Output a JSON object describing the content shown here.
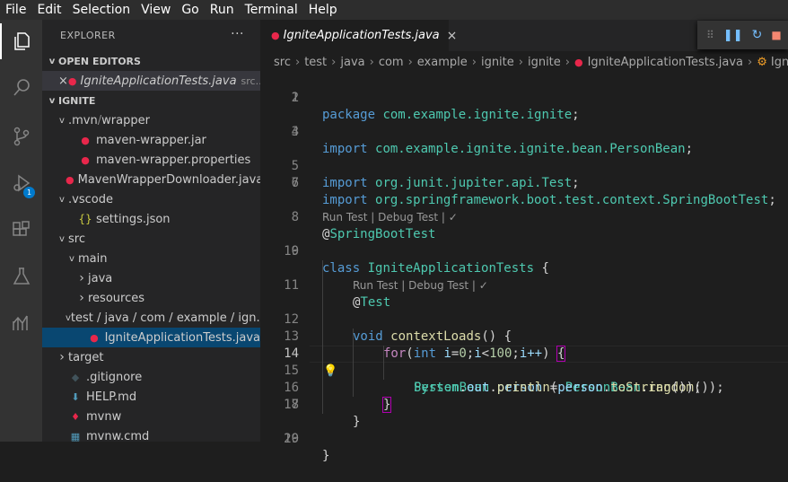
{
  "menu": [
    "File",
    "Edit",
    "Selection",
    "View",
    "Go",
    "Run",
    "Terminal",
    "Help"
  ],
  "activity": {
    "debug_badge": "1"
  },
  "sidebar": {
    "title": "EXPLORER",
    "more": "···",
    "open_editors_label": "OPEN EDITORS",
    "open_editor": {
      "name": "IgniteApplicationTests.java",
      "hint": "src..."
    },
    "project_label": "IGNITE",
    "tree": [
      {
        "label": ".mvn",
        "sep": " / ",
        "label2": "wrapper",
        "indent": 1,
        "chevron": "v",
        "icon": ""
      },
      {
        "label": "maven-wrapper.jar",
        "indent": 2,
        "chevron": "",
        "icon": "java"
      },
      {
        "label": "maven-wrapper.properties",
        "indent": 2,
        "chevron": "",
        "icon": "java"
      },
      {
        "label": "MavenWrapperDownloader.java",
        "indent": 2,
        "chevron": "",
        "icon": "java"
      },
      {
        "label": ".vscode",
        "indent": 1,
        "chevron": "v",
        "icon": ""
      },
      {
        "label": "settings.json",
        "indent": 2,
        "chevron": "",
        "icon": "json"
      },
      {
        "label": "src",
        "indent": 1,
        "chevron": "v",
        "icon": ""
      },
      {
        "label": "main",
        "indent": 2,
        "chevron": "v",
        "icon": ""
      },
      {
        "label": "java",
        "indent": 3,
        "chevron": ">",
        "icon": ""
      },
      {
        "label": "resources",
        "indent": 3,
        "chevron": ">",
        "icon": ""
      },
      {
        "label": "test / java / com / example / ign...",
        "indent": 2,
        "chevron": "v",
        "icon": ""
      },
      {
        "label": "IgniteApplicationTests.java",
        "indent": 3,
        "chevron": "",
        "icon": "java",
        "selected": true
      },
      {
        "label": "target",
        "indent": 1,
        "chevron": ">",
        "icon": ""
      },
      {
        "label": ".gitignore",
        "indent": 1,
        "chevron": "",
        "icon": "git"
      },
      {
        "label": "HELP.md",
        "indent": 1,
        "chevron": "",
        "icon": "md"
      },
      {
        "label": "mvnw",
        "indent": 1,
        "chevron": "",
        "icon": "mvnw"
      },
      {
        "label": "mvnw.cmd",
        "indent": 1,
        "chevron": "",
        "icon": "win"
      }
    ]
  },
  "editor": {
    "tab": {
      "label": "IgniteApplicationTests.java",
      "close": "×"
    },
    "breadcrumb": [
      "src",
      "test",
      "java",
      "com",
      "example",
      "ignite",
      "ignite",
      "IgniteApplicationTests.java",
      "IgniteA..."
    ],
    "codelens": "Run Test | Debug Test | ✓",
    "lines": [
      {
        "n": "1"
      },
      {
        "n": "2"
      },
      {
        "n": "3"
      },
      {
        "n": "4"
      },
      {
        "n": "5"
      },
      {
        "n": "6"
      },
      {
        "n": "7"
      },
      {
        "n": "8"
      },
      {
        "n": "9"
      },
      {
        "n": "10"
      },
      {
        "n": "11"
      },
      {
        "n": "12"
      },
      {
        "n": "13"
      },
      {
        "n": "14"
      },
      {
        "n": "15"
      },
      {
        "n": "16"
      },
      {
        "n": "17"
      },
      {
        "n": "18"
      },
      {
        "n": "19"
      },
      {
        "n": "20"
      }
    ],
    "tokens": {
      "package": "package",
      "pkg_name": "com.example.ignite.ignite",
      "semi": ";",
      "import": "import",
      "imp1": "com.example.ignite.ignite.bean.PersonBean",
      "imp2": "org.junit.jupiter.api.Test",
      "imp3": "org.springframework.boot.test.context.SpringBootTest",
      "at": "@",
      "springboottest": "SpringBootTest",
      "class": "class",
      "classname": "IgniteApplicationTests",
      "lbrace": "{",
      "rbrace": "}",
      "test": "Test",
      "void": "void",
      "method": "contextLoads",
      "parens": "()",
      "for": "for",
      "lparen": "(",
      "int": "int",
      "i": "i",
      "eq": "=",
      "zero": "0",
      "lt": "<",
      "hundred": "100",
      "iinc": "i++",
      "rparen": ")",
      "personbean": "PersonBean",
      "person": "person",
      "random": "random",
      "dot": ".",
      "system": "System",
      "out": "out",
      "println": "println",
      "tostring": "toString",
      "callsemi": "());",
      "callsemi2": "());"
    }
  }
}
